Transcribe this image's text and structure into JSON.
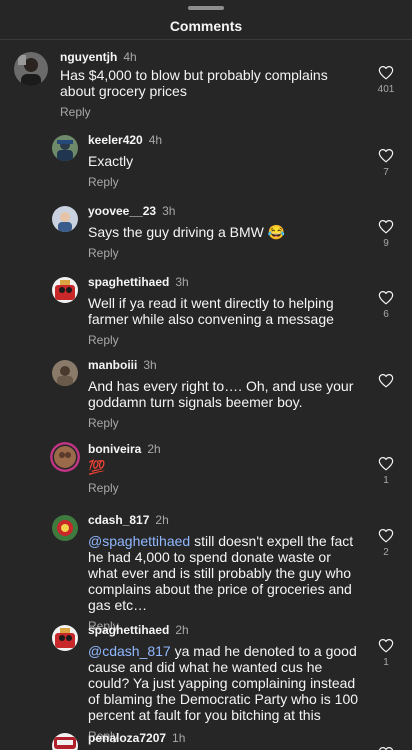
{
  "header": {
    "title": "Comments"
  },
  "comments": [
    {
      "username": "nguyentjh",
      "time": "4h",
      "mention": "",
      "text": "Has $4,000 to blow but probably complains about grocery prices",
      "reply": "Reply",
      "likes": "401"
    },
    {
      "username": "keeler420",
      "time": "4h",
      "mention": "",
      "text": "Exactly",
      "reply": "Reply",
      "likes": "7"
    },
    {
      "username": "yoovee__23",
      "time": "3h",
      "mention": "",
      "text": "Says the guy driving a BMW 😂",
      "reply": "Reply",
      "likes": "9"
    },
    {
      "username": "spaghettihaed",
      "time": "3h",
      "mention": "",
      "text": "Well if ya read it went directly to helping farmer while also convening a message",
      "reply": "Reply",
      "likes": "6"
    },
    {
      "username": "manboiii",
      "time": "3h",
      "mention": "",
      "text": "And has every right to…. Oh, and use your goddamn turn signals beemer boy.",
      "reply": "Reply",
      "likes": ""
    },
    {
      "username": "boniveira",
      "time": "2h",
      "mention": "",
      "text": "💯",
      "reply": "Reply",
      "likes": "1"
    },
    {
      "username": "cdash_817",
      "time": "2h",
      "mention": "@spaghettihaed",
      "text": " still doesn't expell the fact he had 4,000 to spend donate waste or what ever and is still probably the guy who complains about the price of groceries and gas etc…",
      "reply": "Reply",
      "likes": "2"
    },
    {
      "username": "spaghettihaed",
      "time": "2h",
      "mention": "@cdash_817",
      "text": " ya mad he denoted to a good cause and did what he wanted cus he could? Ya just yapping complaining instead of blaming the Democratic Party who is 100 percent at fault for you bitching at this",
      "reply": "Reply",
      "likes": "1"
    },
    {
      "username": "penaloza7207",
      "time": "1h",
      "mention": "",
      "text": "",
      "reply": "",
      "likes": ""
    }
  ],
  "icons": {
    "like": "heart-outline-icon"
  },
  "colors": {
    "background": "#262626",
    "secondary_text": "#a8a8a8",
    "mention": "#90b8ff"
  }
}
